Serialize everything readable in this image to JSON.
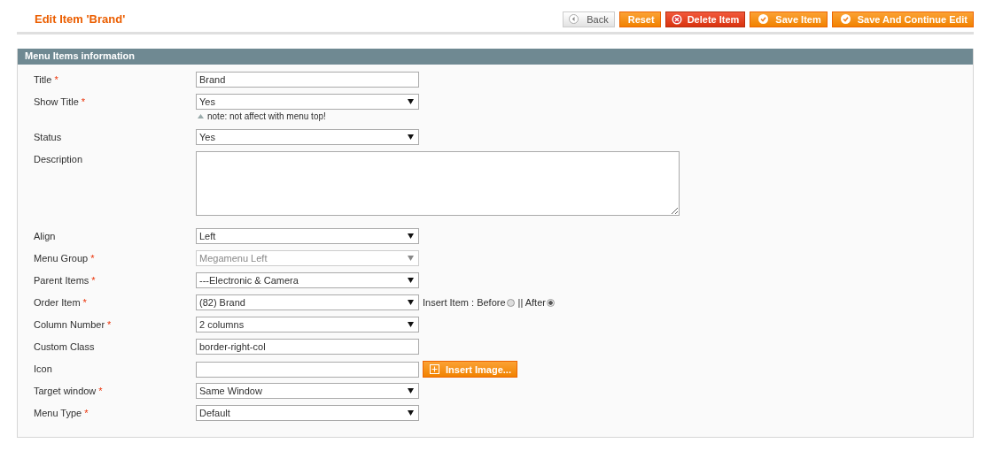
{
  "page_title": "Edit Item 'Brand'",
  "buttons": [
    {
      "kind": "back",
      "label": "Back"
    },
    {
      "kind": "reset",
      "label": "Reset"
    },
    {
      "kind": "delete",
      "label": "Delete Item"
    },
    {
      "kind": "save",
      "label": "Save Item"
    },
    {
      "kind": "save",
      "label": "Save And Continue Edit"
    }
  ],
  "section": {
    "title": "Menu Items information",
    "fields": [
      {
        "kind": "text",
        "label": "Title",
        "required_mark": "*",
        "value": "Brand"
      },
      {
        "kind": "select",
        "label": "Show Title",
        "required_mark": "*",
        "value": "Yes",
        "note": "note: not affect with menu top!"
      },
      {
        "kind": "select",
        "label": "Status",
        "value": "Yes"
      },
      {
        "kind": "textarea",
        "label": "Description"
      },
      {
        "kind": "select",
        "label": "Align",
        "value": "Left"
      },
      {
        "kind": "select",
        "label": "Menu Group",
        "required_mark": "*",
        "value": "Megamenu Left",
        "disabled": true
      },
      {
        "kind": "select",
        "label": "Parent Items",
        "required_mark": "*",
        "value": "---Electronic & Camera"
      },
      {
        "kind": "select",
        "label": "Order Item",
        "required_mark": "*",
        "value": "(82) Brand",
        "options": [
          {
            "label": "Insert Item : Before",
            "selected": false
          },
          {
            "label": "|| After",
            "selected": true
          }
        ]
      },
      {
        "kind": "select",
        "label": "Column Number",
        "required_mark": "*",
        "value": "2 columns"
      },
      {
        "kind": "text",
        "label": "Custom Class",
        "value": "border-right-col"
      },
      {
        "kind": "text",
        "label": "Icon",
        "button": "Insert Image..."
      },
      {
        "kind": "select",
        "label": "Target window",
        "required_mark": "*",
        "value": "Same Window"
      },
      {
        "kind": "select",
        "label": "Menu Type",
        "required_mark": "*",
        "value": "Default"
      }
    ]
  }
}
